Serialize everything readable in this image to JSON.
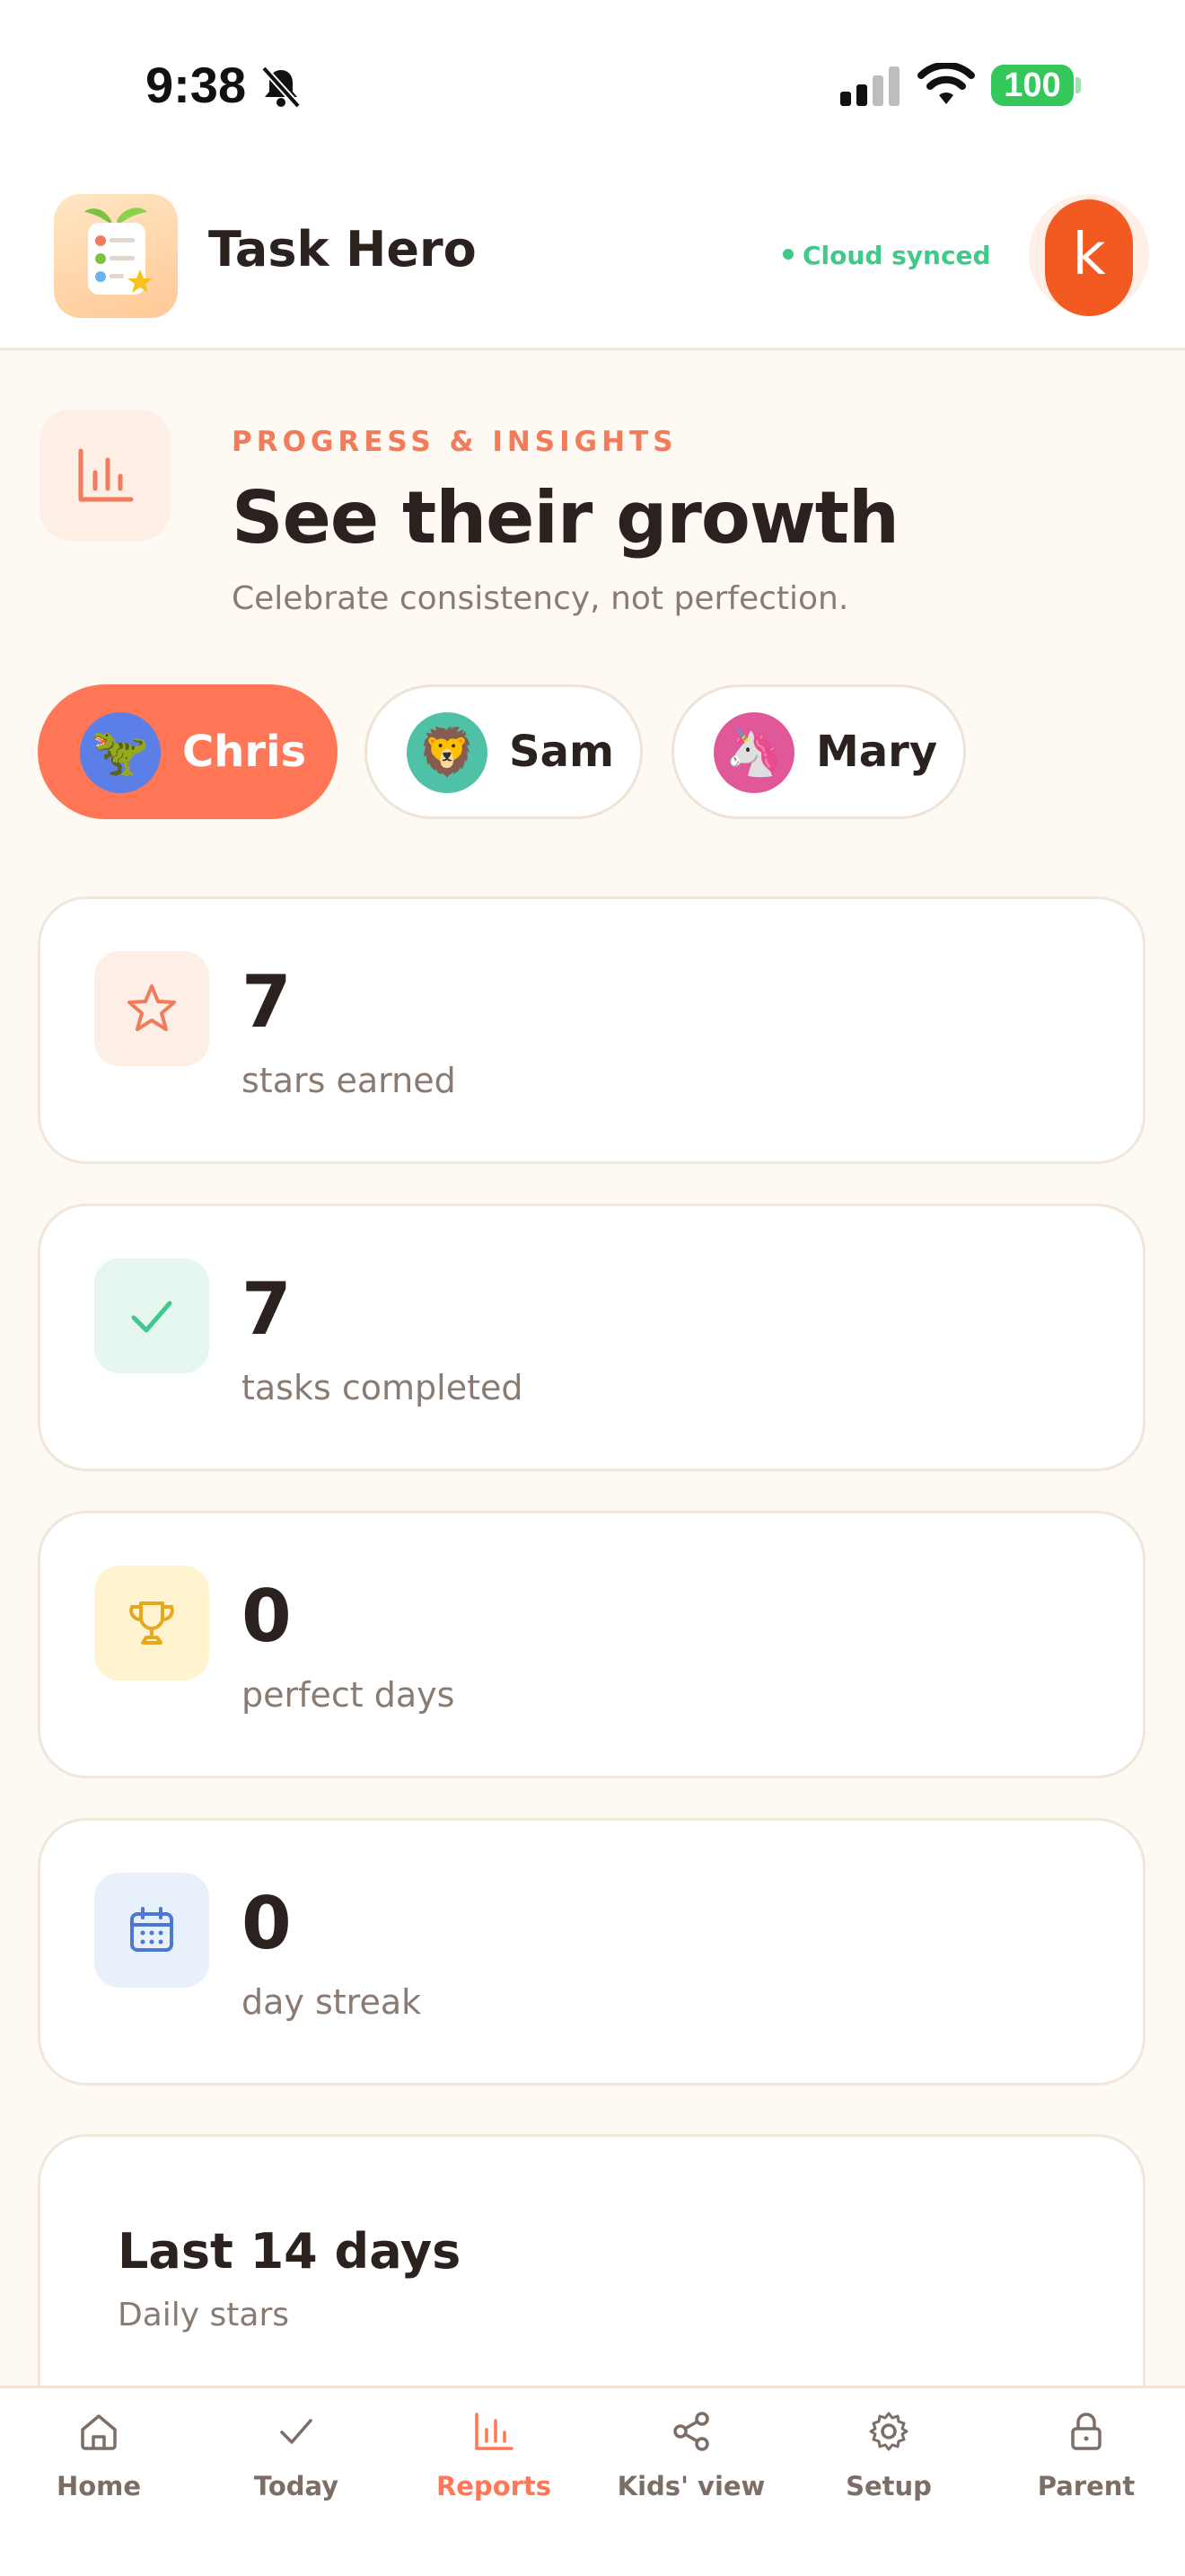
{
  "status_bar": {
    "time": "9:38",
    "battery": "100"
  },
  "header": {
    "app_name": "Task Hero",
    "sync_status": "Cloud synced",
    "avatar_initial": "k"
  },
  "hero": {
    "eyebrow": "PROGRESS & INSIGHTS",
    "title": "See their growth",
    "subtitle": "Celebrate consistency, not perfection."
  },
  "children": [
    {
      "name": "Chris",
      "emoji": "🦖",
      "color": "#5B7FE6",
      "selected": true
    },
    {
      "name": "Sam",
      "emoji": "🦁",
      "color": "#4FC1A6",
      "selected": false
    },
    {
      "name": "Mary",
      "emoji": "🦄",
      "color": "#E0579A",
      "selected": false
    }
  ],
  "stats": [
    {
      "value": "7",
      "label": "stars earned",
      "icon": "star-icon",
      "tint": "#FDEEE6",
      "color": "#F07C5C"
    },
    {
      "value": "7",
      "label": "tasks completed",
      "icon": "check-icon",
      "tint": "#E5F7EE",
      "color": "#3FC98A"
    },
    {
      "value": "0",
      "label": "perfect days",
      "icon": "trophy-icon",
      "tint": "#FFF4CF",
      "color": "#E6A91E"
    },
    {
      "value": "0",
      "label": "day streak",
      "icon": "calendar-icon",
      "tint": "#E8F0FC",
      "color": "#4A78D2"
    }
  ],
  "chart_card": {
    "title": "Last 14 days",
    "subtitle": "Daily stars"
  },
  "nav": {
    "active": "Reports",
    "items": [
      {
        "label": "Home",
        "icon": "home-icon"
      },
      {
        "label": "Today",
        "icon": "check-icon"
      },
      {
        "label": "Reports",
        "icon": "bar-chart-icon"
      },
      {
        "label": "Kids' view",
        "icon": "share-icon"
      },
      {
        "label": "Setup",
        "icon": "gear-icon"
      },
      {
        "label": "Parent",
        "icon": "lock-icon"
      }
    ]
  },
  "colors": {
    "accent": "#FF7757",
    "background": "#FFF9F4",
    "sync_green": "#3FC98A",
    "avatar": "#F35A22"
  }
}
